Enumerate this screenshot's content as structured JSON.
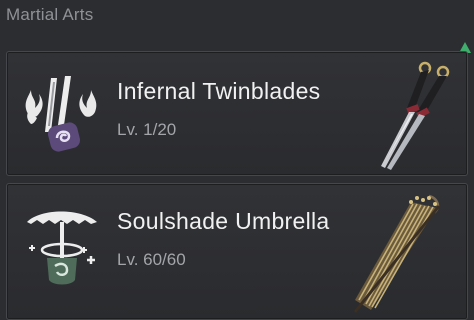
{
  "section": {
    "title": "Martial Arts"
  },
  "martial_arts": [
    {
      "name": "Infernal Twinblades",
      "level": "Lv. 1/20",
      "icon": "twinblades-flame-icon",
      "weapon": "twinblades-weapon"
    },
    {
      "name": "Soulshade Umbrella",
      "level": "Lv. 60/60",
      "icon": "umbrella-soul-icon",
      "weapon": "umbrella-weapon"
    }
  ],
  "colors": {
    "background": "#2c2d30",
    "card": "#313236",
    "accent_purple": "#5b4a7a",
    "scroll_arrow": "#3fae6c"
  },
  "scroll_indicator": {
    "icon": "up-arrow-icon"
  }
}
